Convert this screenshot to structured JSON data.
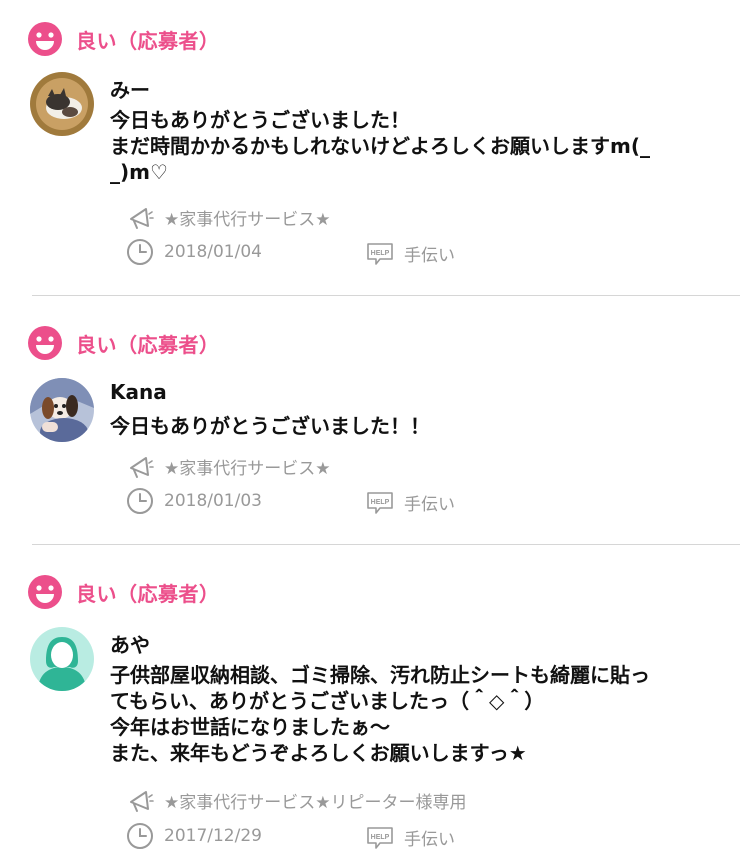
{
  "colors": {
    "accent": "#ec4f8b",
    "muted": "#999999",
    "divider": "#d6d6d6"
  },
  "reviews": [
    {
      "rating_icon": "smile-icon",
      "rating_label": "良い（応募者）",
      "avatar": "cat-photo-avatar",
      "name": "みー",
      "comment_lines": [
        "今日もありがとうございました！",
        "まだ時間かかるかもしれないけどよろしくお願いしますm(_",
        "_)m♡"
      ],
      "service_icon": "megaphone-icon",
      "service": "★家事代行サービス★",
      "date_icon": "clock-icon",
      "date": "2018/01/04",
      "category_icon": "help-icon",
      "category": "手伝い"
    },
    {
      "rating_icon": "smile-icon",
      "rating_label": "良い（応募者）",
      "avatar": "dog-photo-avatar",
      "name": "Kana",
      "comment_lines": [
        "今日もありがとうございました！！"
      ],
      "service_icon": "megaphone-icon",
      "service": "★家事代行サービス★",
      "date_icon": "clock-icon",
      "date": "2018/01/03",
      "category_icon": "help-icon",
      "category": "手伝い"
    },
    {
      "rating_icon": "smile-icon",
      "rating_label": "良い（応募者）",
      "avatar": "default-user-avatar",
      "name": "あや",
      "comment_lines": [
        "子供部屋収納相談、ゴミ掃除、汚れ防止シートも綺麗に貼っ",
        "てもらい、ありがとうございましたっ（＾◇＾）",
        "今年はお世話になりましたぁ〜",
        "また、来年もどうぞよろしくお願いしますっ★"
      ],
      "service_icon": "megaphone-icon",
      "service": "★家事代行サービス★リピーター様専用",
      "date_icon": "clock-icon",
      "date": "2017/12/29",
      "category_icon": "help-icon",
      "category": "手伝い"
    }
  ]
}
